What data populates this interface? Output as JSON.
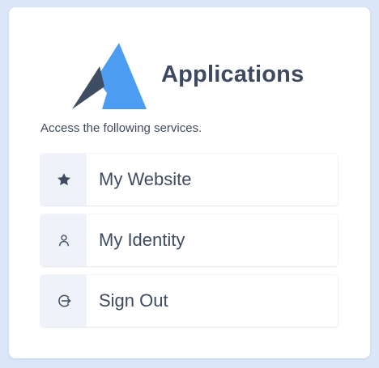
{
  "colors": {
    "page_background": "#dbe7f8",
    "card_background": "#ffffff",
    "text": "#3d4a60",
    "icon_background": "#eff3f9",
    "logo_light": "#4c9cf1",
    "logo_dark": "#3f4d63"
  },
  "header": {
    "title": "Applications",
    "logo_icon": "triangle-logo"
  },
  "subtitle": "Access the following services.",
  "services": [
    {
      "label": "My Website",
      "icon": "star-icon"
    },
    {
      "label": "My Identity",
      "icon": "user-icon"
    },
    {
      "label": "Sign Out",
      "icon": "sign-out-icon"
    }
  ]
}
